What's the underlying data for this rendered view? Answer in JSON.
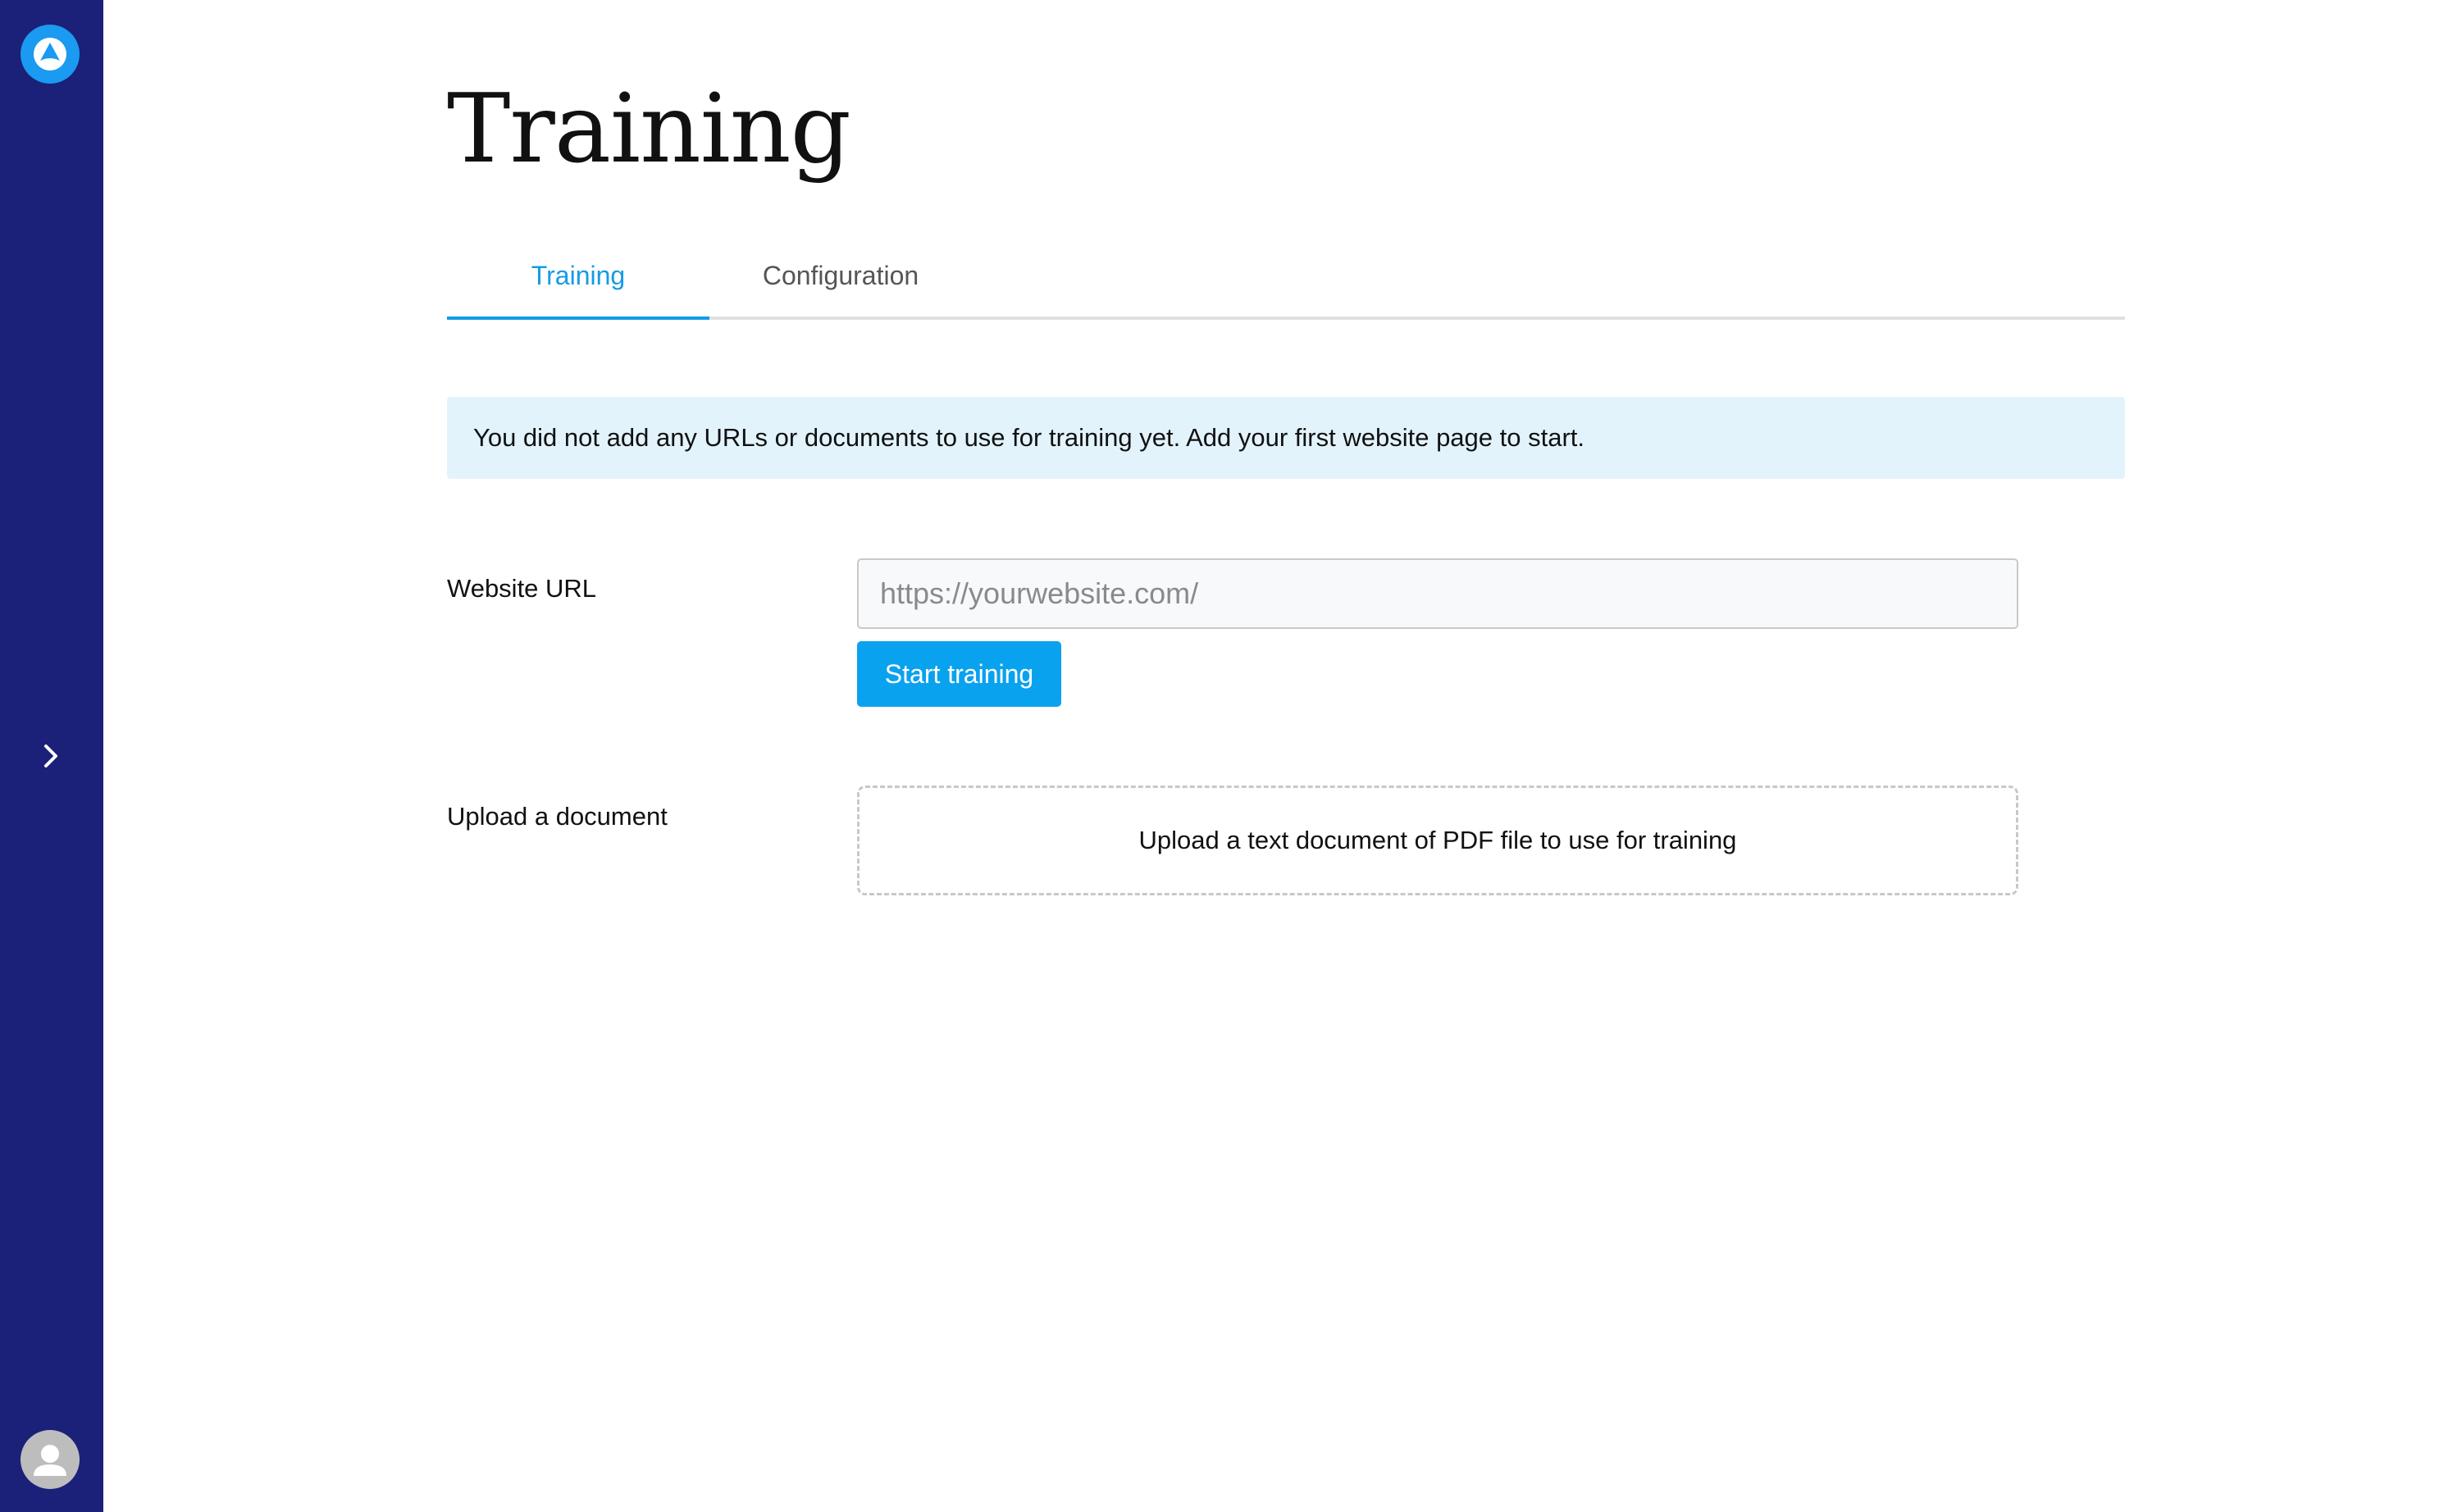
{
  "sidebar": {
    "logo_icon": "logo-icon",
    "expand_icon": "chevron-right-icon",
    "avatar_icon": "user-avatar-icon",
    "background_color": "#1b2079"
  },
  "page": {
    "title": "Training"
  },
  "tabs": [
    {
      "label": "Training",
      "active": true
    },
    {
      "label": "Configuration",
      "active": false
    }
  ],
  "banner": {
    "text": "You did not add any URLs or documents to use for training yet. Add your first website page to start.",
    "background_color": "#e3f3fc"
  },
  "website_url": {
    "label": "Website URL",
    "placeholder": "https://yourwebsite.com/",
    "value": ""
  },
  "start_button": {
    "label": "Start training",
    "color": "#09a2ef"
  },
  "upload": {
    "label": "Upload a document",
    "dropzone_text": "Upload a text document of PDF file to use for training"
  },
  "colors": {
    "accent": "#159be4"
  }
}
